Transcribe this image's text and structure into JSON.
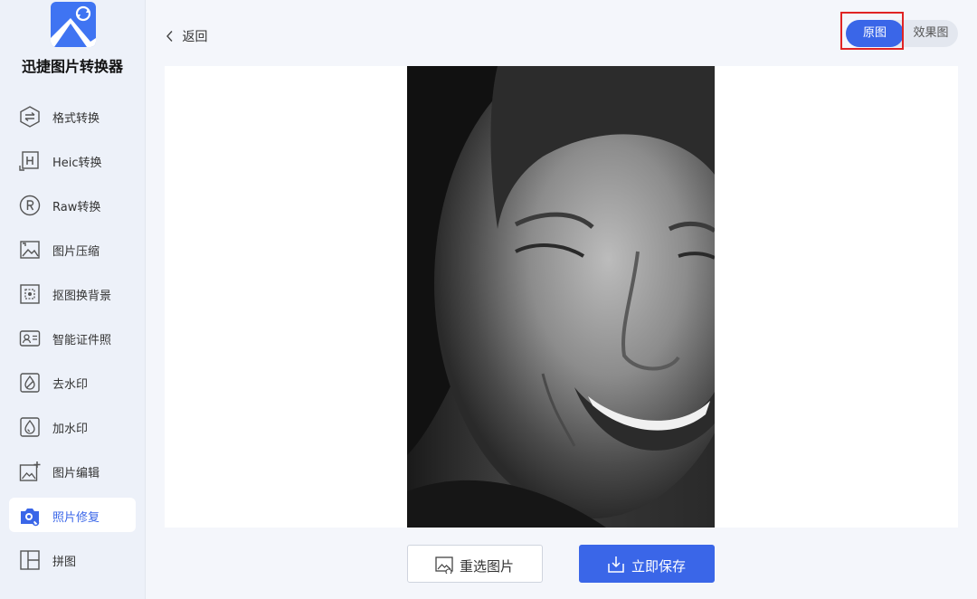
{
  "app": {
    "name": "迅捷图片转换器",
    "accent": "#3a66e8"
  },
  "sidebar": {
    "items": [
      {
        "label": "格式转换",
        "icon": "format-convert-icon"
      },
      {
        "label": "Heic转换",
        "icon": "heic-icon"
      },
      {
        "label": "Raw转换",
        "icon": "raw-icon"
      },
      {
        "label": "图片压缩",
        "icon": "image-compress-icon"
      },
      {
        "label": "抠图换背景",
        "icon": "cutout-icon"
      },
      {
        "label": "智能证件照",
        "icon": "id-photo-icon"
      },
      {
        "label": "去水印",
        "icon": "remove-watermark-icon"
      },
      {
        "label": "加水印",
        "icon": "add-watermark-icon"
      },
      {
        "label": "图片编辑",
        "icon": "image-edit-icon"
      },
      {
        "label": "照片修复",
        "icon": "photo-repair-icon",
        "active": true
      },
      {
        "label": "拼图",
        "icon": "collage-icon"
      }
    ]
  },
  "header": {
    "back_label": "返回",
    "toggle": {
      "original_label": "原图",
      "effect_label": "效果图",
      "selected": "原图"
    }
  },
  "footer": {
    "reselect_label": "重选图片",
    "save_label": "立即保存"
  }
}
